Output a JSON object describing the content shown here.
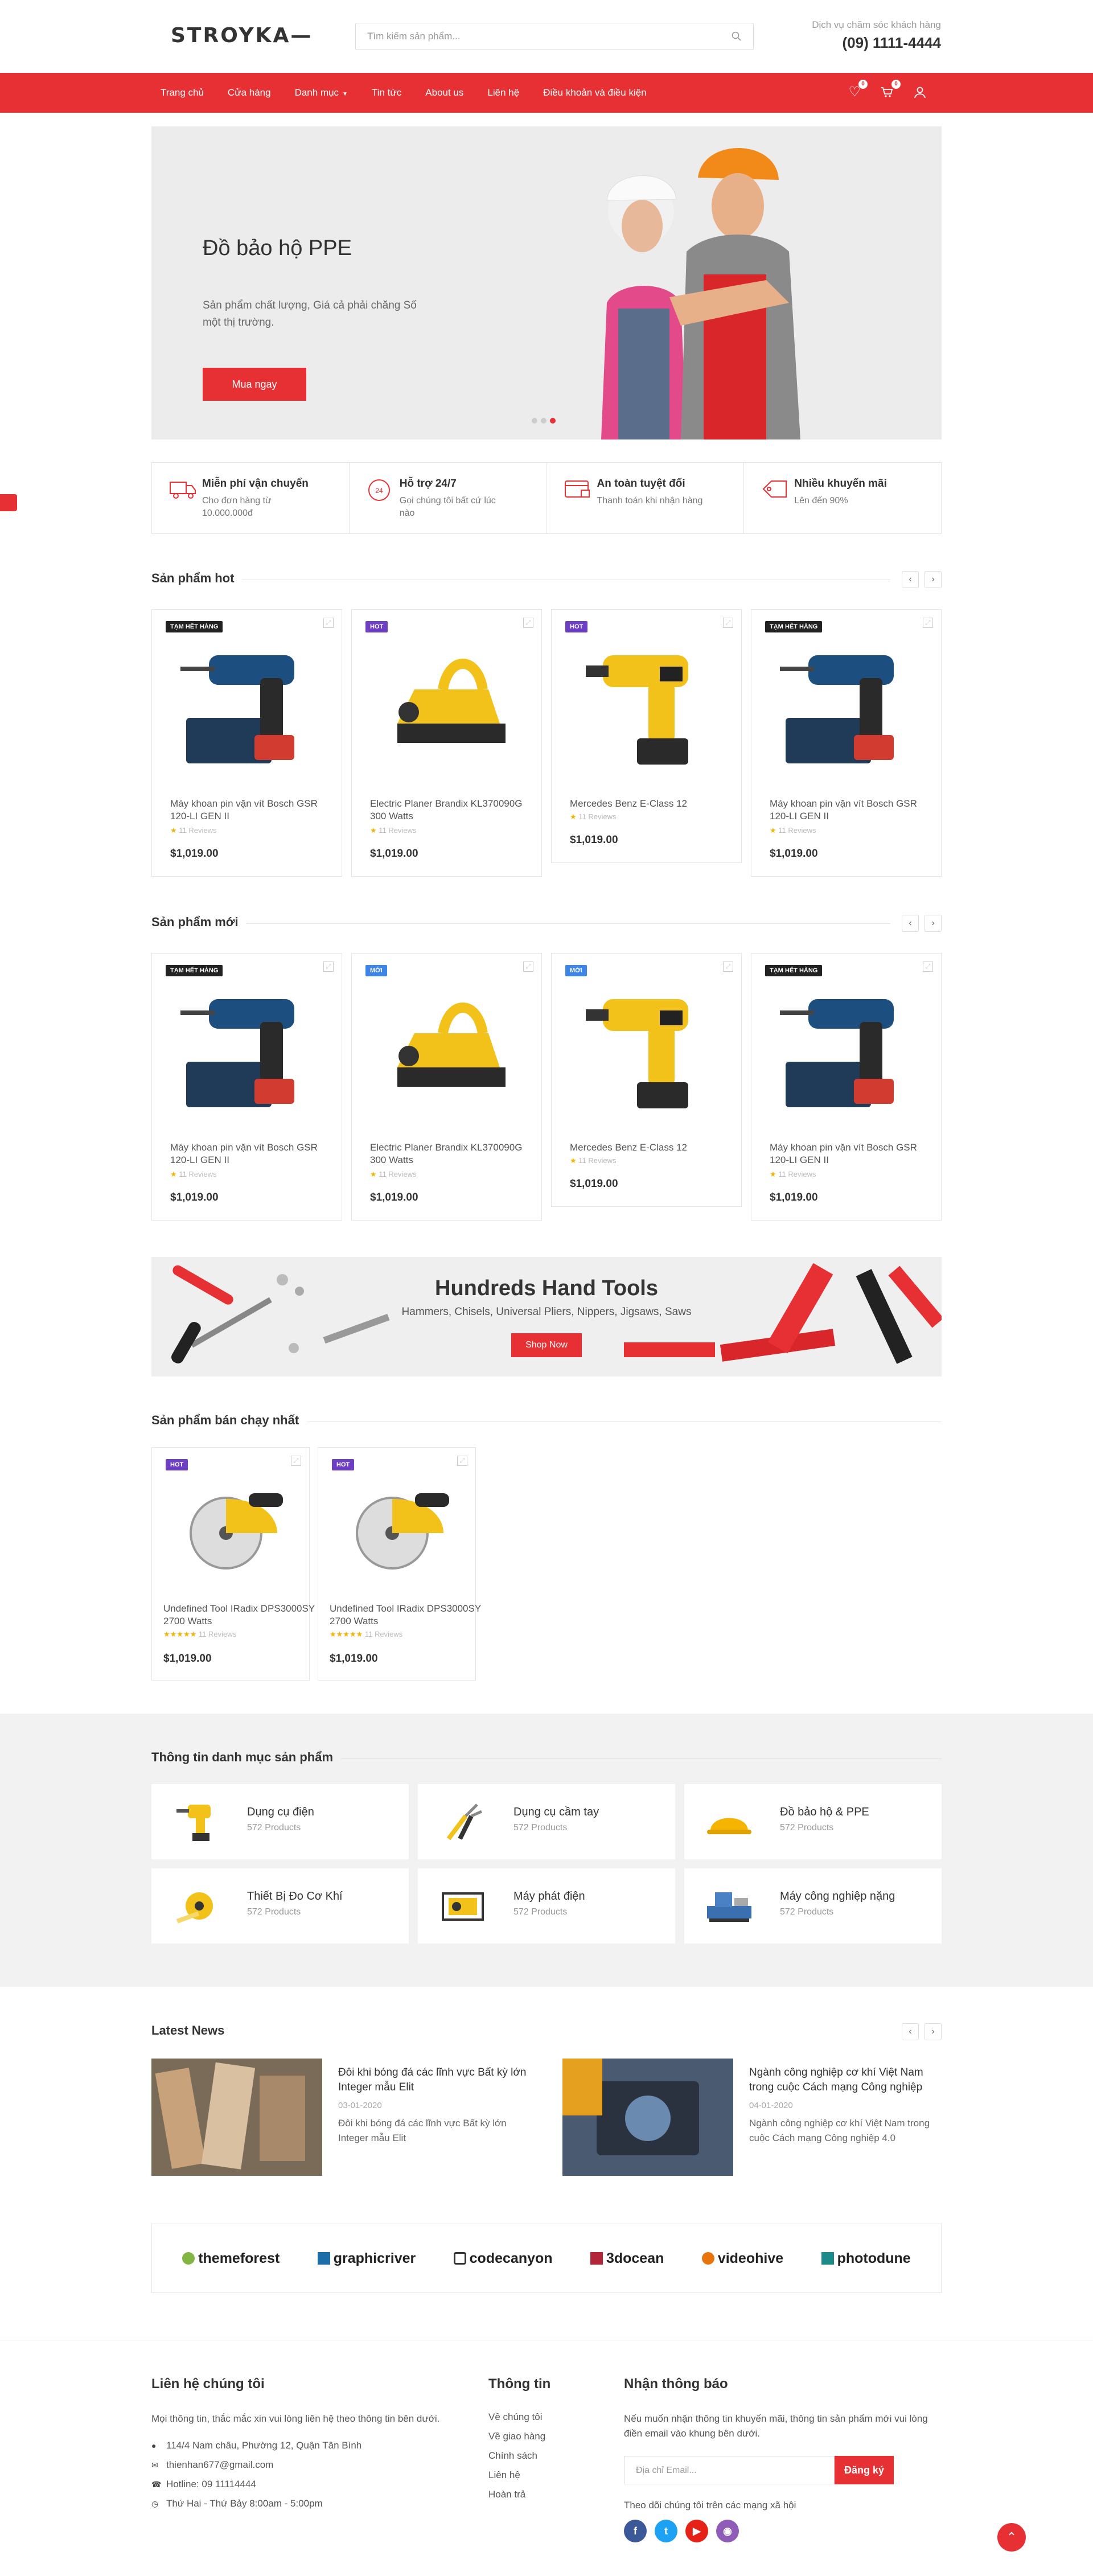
{
  "header": {
    "logo": "STROYKA",
    "search_placeholder": "Tìm kiếm sản phẩm...",
    "service_label": "Dịch vụ chăm sóc khách hàng",
    "phone": "(09) 1111-4444"
  },
  "nav": {
    "items": [
      "Trang chủ",
      "Cửa hàng",
      "Danh mục",
      "Tin tức",
      "About us",
      "Liên hệ",
      "Điều khoản và điều kiện"
    ],
    "wishlist_count": "0",
    "cart_count": "0"
  },
  "hero": {
    "title": "Đồ bảo hộ PPE",
    "desc": "Sản phẩm chất lượng, Giá cả phải chăng Số một thị trường.",
    "button": "Mua ngay"
  },
  "features": [
    {
      "icon": "free-shipping-icon",
      "title": "Miễn phí vận chuyển",
      "desc": "Cho đơn hàng từ 10.000.000đ"
    },
    {
      "icon": "support-24-icon",
      "title": "Hỗ trợ 24/7",
      "desc": "Gọi chúng tôi bất cứ lúc nào"
    },
    {
      "icon": "secure-payment-icon",
      "title": "An toàn tuyệt đối",
      "desc": "Thanh toán khi nhận hàng"
    },
    {
      "icon": "hot-offer-icon",
      "title": "Nhiều khuyến mãi",
      "desc": "Lên đến 90%"
    }
  ],
  "hot": {
    "title": "Sản phẩm hot",
    "products": [
      {
        "tag": "TẠM HẾT HÀNG",
        "name": "Máy khoan pin vặn vít Bosch GSR 120-LI GEN II",
        "reviews": "11 Reviews",
        "price": "$1,019.00"
      },
      {
        "tag": "HOT",
        "name": "Electric Planer Brandix KL370090G 300 Watts",
        "reviews": "11 Reviews",
        "price": "$1,019.00"
      },
      {
        "tag": "HOT",
        "name": "Mercedes Benz E-Class 12",
        "reviews": "11 Reviews",
        "price": "$1,019.00"
      },
      {
        "tag": "TẠM HẾT HÀNG",
        "name": "Máy khoan pin vặn vít Bosch GSR 120-LI GEN II",
        "reviews": "11 Reviews",
        "price": "$1,019.00"
      }
    ]
  },
  "new": {
    "title": "Sản phẩm mới",
    "products": [
      {
        "tag": "TẠM HẾT HÀNG",
        "name": "Máy khoan pin vặn vít Bosch GSR 120-LI GEN II",
        "reviews": "11 Reviews",
        "price": "$1,019.00"
      },
      {
        "tag": "MỚI",
        "name": "Electric Planer Brandix KL370090G 300 Watts",
        "reviews": "11 Reviews",
        "price": "$1,019.00"
      },
      {
        "tag": "MỚI",
        "name": "Mercedes Benz E-Class 12",
        "reviews": "11 Reviews",
        "price": "$1,019.00"
      },
      {
        "tag": "TẠM HẾT HÀNG",
        "name": "Máy khoan pin vặn vít Bosch GSR 120-LI GEN II",
        "reviews": "11 Reviews",
        "price": "$1,019.00"
      }
    ]
  },
  "banner": {
    "title": "Hundreds Hand Tools",
    "subtitle": "Hammers, Chisels, Universal Pliers, Nippers, Jigsaws, Saws",
    "button": "Shop Now"
  },
  "best": {
    "title": "Sản phẩm bán chạy nhất",
    "products": [
      {
        "tag": "HOT",
        "name": "Undefined Tool IRadix DPS3000SY 2700 Watts",
        "reviews": "11 Reviews",
        "price": "$1,019.00"
      },
      {
        "tag": "HOT",
        "name": "Undefined Tool IRadix DPS3000SY 2700 Watts",
        "reviews": "11 Reviews",
        "price": "$1,019.00"
      }
    ]
  },
  "categories": {
    "title": "Thông tin danh mục sản phẩm",
    "items": [
      {
        "name": "Dụng cụ điện",
        "count": "572 Products"
      },
      {
        "name": "Dụng cụ cầm tay",
        "count": "572 Products"
      },
      {
        "name": "Đồ bảo hộ & PPE",
        "count": "572 Products"
      },
      {
        "name": "Thiết Bị Đo Cơ Khí",
        "count": "572 Products"
      },
      {
        "name": "Máy phát điện",
        "count": "572 Products"
      },
      {
        "name": "Máy công nghiệp nặng",
        "count": "572 Products"
      }
    ]
  },
  "news": {
    "title": "Latest News",
    "items": [
      {
        "title": "Đôi khi bóng đá các lĩnh vực Bất kỳ lớn Integer mẫu Elit",
        "date": "03-01-2020",
        "excerpt": "Đôi khi bóng đá các lĩnh vực Bất kỳ lớn Integer mẫu Elit"
      },
      {
        "title": "Ngành công nghiệp cơ khí Việt Nam trong cuộc Cách mạng Công nghiệp",
        "date": "04-01-2020",
        "excerpt": "Ngành công nghiệp cơ khí Việt Nam trong cuộc Cách mạng Công nghiệp 4.0"
      }
    ]
  },
  "brands": [
    "themeforest",
    "graphicriver",
    "codecanyon",
    "3docean",
    "videohive",
    "photodune"
  ],
  "footer": {
    "contact_title": "Liên hệ chúng tôi",
    "contact_desc": "Mọi thông tin, thắc mắc xin vui lòng liên hệ theo thông tin bên dưới.",
    "address": "114/4 Nam châu, Phường 12, Quận Tân Bình",
    "email": "thienhan677@gmail.com",
    "hotline": "Hotline: 09 11114444",
    "hours": "Thứ Hai - Thứ Bảy 8:00am - 5:00pm",
    "info_title": "Thông tin",
    "info_links": [
      "Về chúng tôi",
      "Về giao hàng",
      "Chính sách",
      "Liên hệ",
      "Hoàn trả"
    ],
    "newsletter_title": "Nhận thông báo",
    "newsletter_desc": "Nếu muốn nhận thông tin khuyến mãi, thông tin sản phẩm mới vui lòng điền email vào khung bên dưới.",
    "email_placeholder": "Địa chỉ Email...",
    "subscribe": "Đăng ký",
    "follow": "Theo dõi chúng tôi trên các mạng xã hội"
  },
  "colors": {
    "accent": "#e63033",
    "hot": "#6c3fc4",
    "new": "#3d85e8"
  }
}
